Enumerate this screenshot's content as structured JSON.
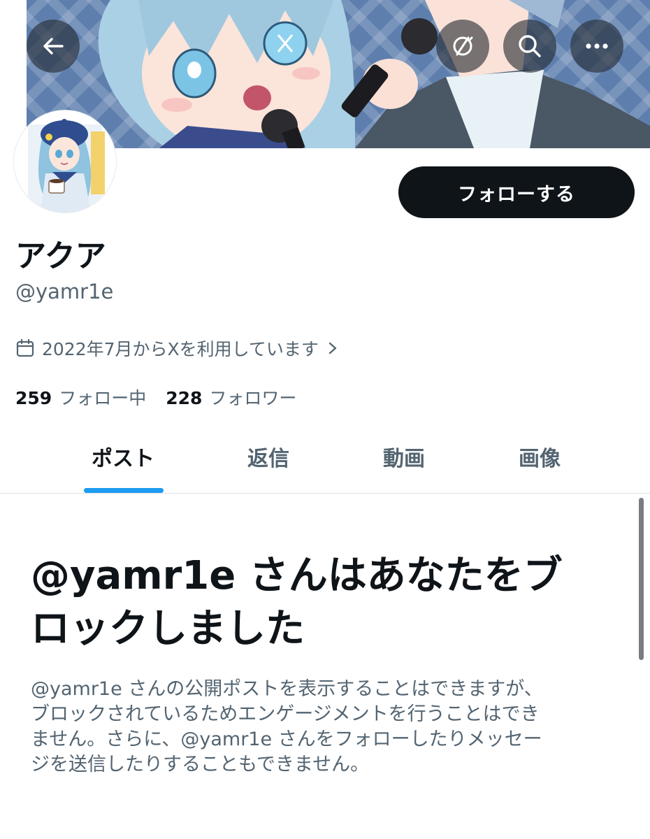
{
  "header": {
    "back_icon": "arrow-left-icon",
    "translate_icon": "no-translate-icon",
    "search_icon": "search-icon",
    "more_icon": "more-horizontal-icon"
  },
  "profile": {
    "display_name": "アクア",
    "handle": "@yamr1e",
    "joined": "2022年7月からXを利用しています",
    "following_count": "259",
    "following_label": "フォロー中",
    "followers_count": "228",
    "followers_label": "フォロワー"
  },
  "actions": {
    "follow_label": "フォローする"
  },
  "tabs": [
    {
      "label": "ポスト",
      "active": true
    },
    {
      "label": "返信",
      "active": false
    },
    {
      "label": "動画",
      "active": false
    },
    {
      "label": "画像",
      "active": false
    }
  ],
  "blocked": {
    "title_line1": "@yamr1e さんはあなたをブ",
    "title_line2": "ロックしました",
    "text_line1": "@yamr1e さんの公開ポストを表示することはできますが、",
    "text_line2": "ブロックされているためエンゲージメントを行うことはでき",
    "text_line3": "ません。さらに、@yamr1e さんをフォローしたりメッセー",
    "text_line4": "ジを送信したりすることもできません。"
  },
  "colors": {
    "accent": "#1d9bf0",
    "text_primary": "#0f1419",
    "text_secondary": "#536471",
    "button_dark": "#0f1419"
  }
}
